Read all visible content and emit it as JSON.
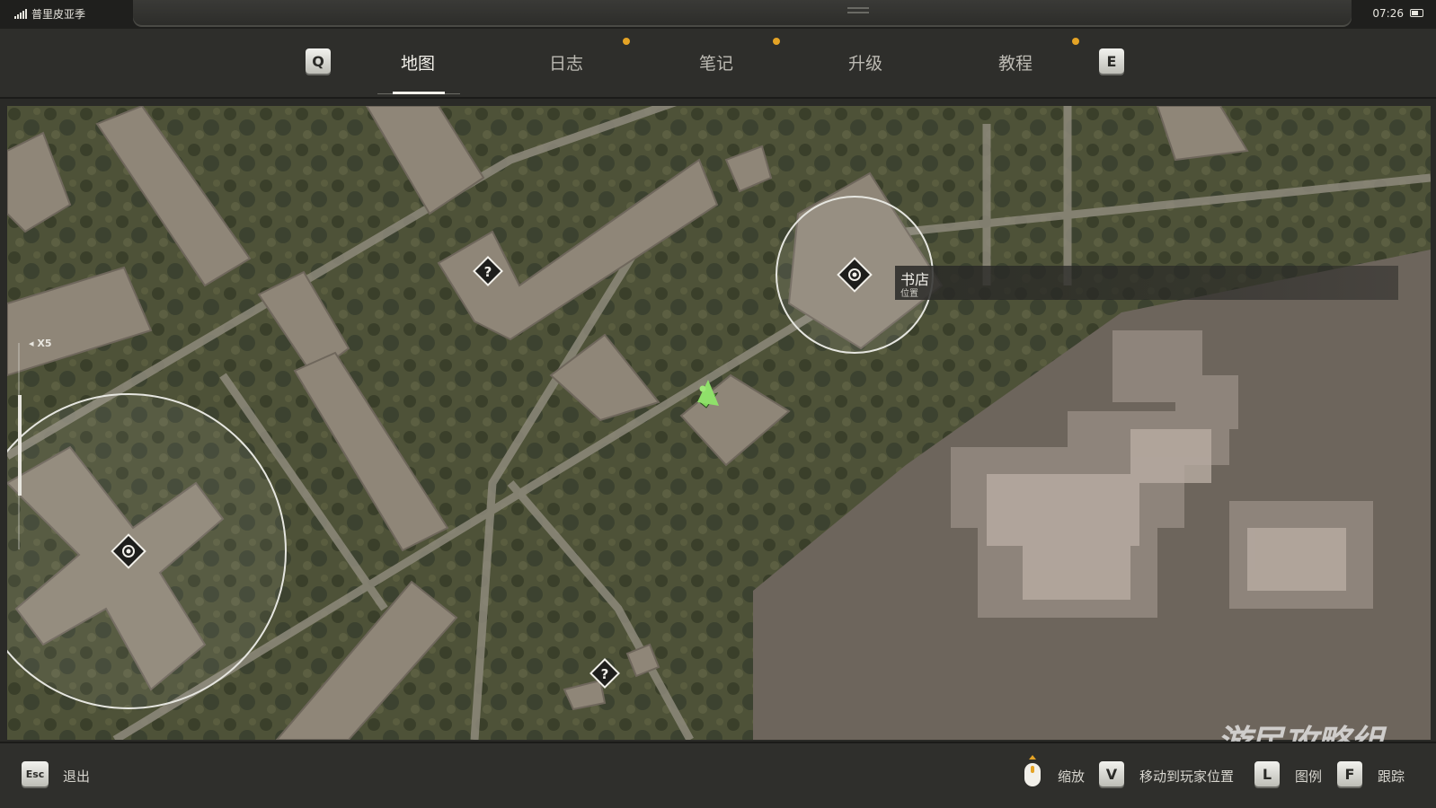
{
  "status": {
    "carrier": "普里皮亚季",
    "time": "07:26"
  },
  "tabs": {
    "prev_key": "Q",
    "next_key": "E",
    "items": [
      {
        "label": "地图",
        "active": true,
        "notification": false
      },
      {
        "label": "日志",
        "active": false,
        "notification": true
      },
      {
        "label": "笔记",
        "active": false,
        "notification": true
      },
      {
        "label": "升级",
        "active": false,
        "notification": false
      },
      {
        "label": "教程",
        "active": false,
        "notification": true
      }
    ],
    "notification_color": "#e4a325"
  },
  "map": {
    "zoom_label": "X5",
    "marker": {
      "title": "书店",
      "subtitle": "位置"
    },
    "icons": [
      "quest-unknown-icon",
      "quest-unknown-icon",
      "location-target-icon",
      "location-target-icon",
      "player-arrow-icon"
    ],
    "player_color": "#7fd65a",
    "watermark": "游民攻略组"
  },
  "footer": {
    "exit_key": "Esc",
    "exit_label": "退出",
    "zoom_label": "缩放",
    "move_key": "V",
    "move_label": "移动到玩家位置",
    "legend_key": "L",
    "legend_label": "图例",
    "track_key": "F",
    "track_label": "跟踪"
  }
}
